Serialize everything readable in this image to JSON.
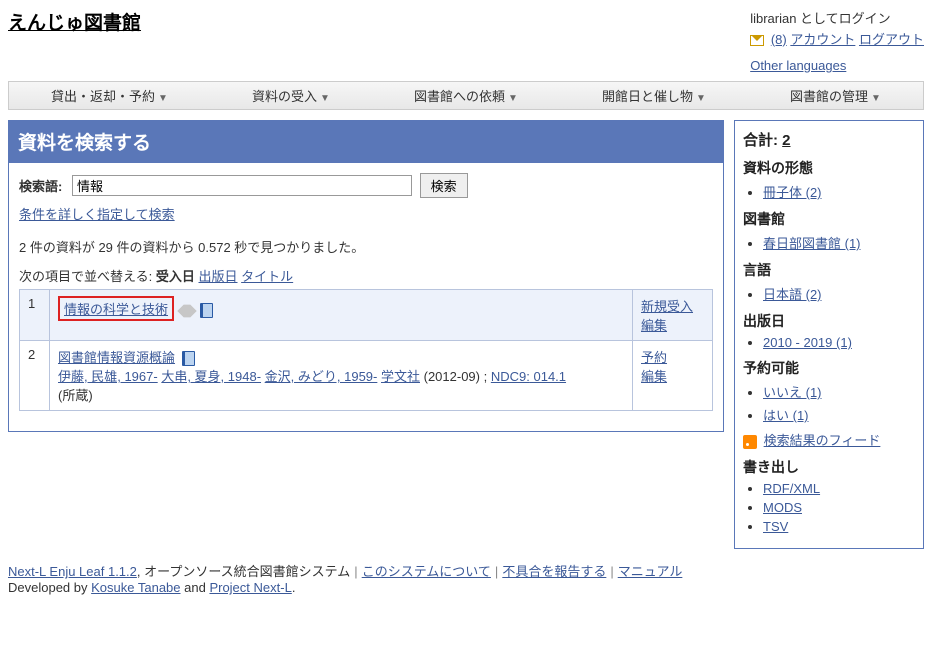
{
  "header": {
    "site_title": "えんじゅ図書館",
    "login_as": "librarian としてログイン",
    "msg_count": "(8)",
    "account": "アカウント",
    "logout": "ログアウト",
    "other_lang": "Other languages"
  },
  "menu": {
    "items": [
      "貸出・返却・予約",
      "資料の受入",
      "図書館への依頼",
      "開館日と催し物",
      "図書館の管理"
    ]
  },
  "search": {
    "heading": "資料を検索する",
    "label": "検索語:",
    "value": "情報",
    "button": "検索",
    "advanced": "条件を詳しく指定して検索",
    "count_line": "2 件の資料が 29 件の資料から 0.572 秒で見つかりました。",
    "sort_prefix": "次の項目で並べ替える:",
    "sort_current": "受入日",
    "sort_options": [
      "出版日",
      "タイトル"
    ]
  },
  "results": [
    {
      "num": "1",
      "title": "情報の科学と技術",
      "highlighted": true,
      "detail_lines": [],
      "actions": [
        "新規受入",
        "編集"
      ]
    },
    {
      "num": "2",
      "title": "図書館情報資源概論",
      "highlighted": false,
      "authors": [
        {
          "text": "伊藤, 民雄, 1967-",
          "link": true
        },
        {
          "text": "大串, 夏身, 1948-",
          "link": true
        },
        {
          "text": "金沢, みどり, 1959-",
          "link": true
        },
        {
          "text": "学文社",
          "link": true
        }
      ],
      "pubdate": "(2012-09)",
      "ndc_label": "NDC9:",
      "ndc_value": "014.1",
      "holdings": "(所蔵)",
      "actions": [
        "予約",
        "編集"
      ]
    }
  ],
  "facets": {
    "total_label": "合計:",
    "total_value": "2",
    "groups": [
      {
        "heading": "資料の形態",
        "items": [
          "冊子体 (2)"
        ]
      },
      {
        "heading": "図書館",
        "items": [
          "春日部図書館 (1)"
        ]
      },
      {
        "heading": "言語",
        "items": [
          "日本語 (2)"
        ]
      },
      {
        "heading": "出版日",
        "items": [
          "2010 - 2019 (1)"
        ]
      },
      {
        "heading": "予約可能",
        "items": [
          "いいえ (1)",
          "はい (1)"
        ]
      }
    ],
    "feed": "検索結果のフィード",
    "export_heading": "書き出し",
    "exports": [
      "RDF/XML",
      "MODS",
      "TSV"
    ]
  },
  "footer": {
    "product": "Next-L Enju Leaf 1.1.2",
    "tagline": ", オープンソース統合図書館システム",
    "about": "このシステムについて",
    "report": "不具合を報告する",
    "manual": "マニュアル",
    "dev_prefix": "Developed by ",
    "dev1": "Kosuke Tanabe",
    "dev_and": " and ",
    "dev2": "Project Next-L",
    "dev_suffix": "."
  }
}
